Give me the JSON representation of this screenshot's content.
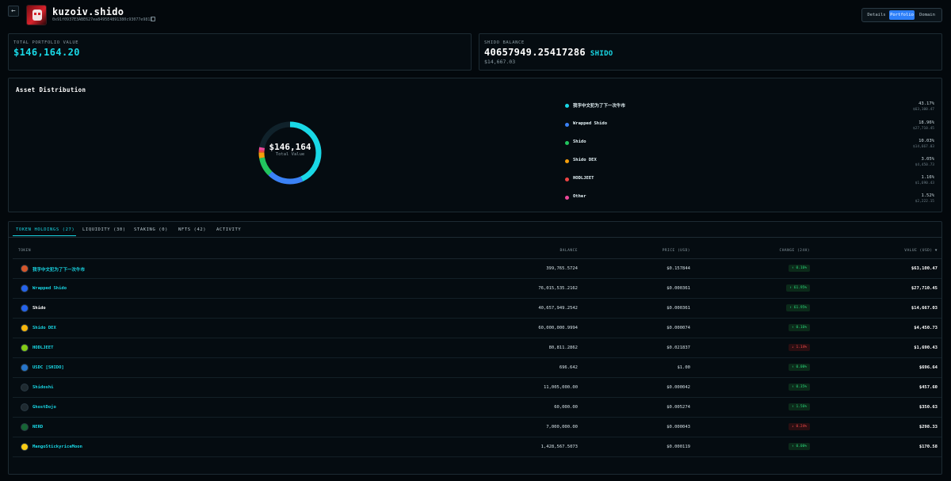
{
  "header": {
    "back_icon": "←",
    "name": "kuzoiv.shido",
    "address": "0x91f0937E3ABE627ea8495E4891380c93077e9813",
    "view_tabs": [
      "Details",
      "Portfolio",
      "Domain"
    ],
    "active_view": "Portfolio"
  },
  "portfolio": {
    "label": "TOTAL PORTFOLIO VALUE",
    "value": "$146,164.20"
  },
  "shido_balance": {
    "label": "SHIDO BALANCE",
    "amount": "40657949.25417286",
    "ticker": "SHIDO",
    "usd": "$14,667.03"
  },
  "distribution": {
    "title": "Asset Distribution",
    "center_value": "$146,164",
    "center_label": "Total Value",
    "items": [
      {
        "name": "我字中文犯为了下一次牛市",
        "pct": "43.17%",
        "usd": "$63,100.47",
        "color": "#19d8e6",
        "share": 43.17
      },
      {
        "name": "Wrapped Shido",
        "pct": "18.96%",
        "usd": "$27,710.45",
        "color": "#3b82f6",
        "share": 18.96
      },
      {
        "name": "Shido",
        "pct": "10.03%",
        "usd": "$14,667.03",
        "color": "#22c55e",
        "share": 10.03
      },
      {
        "name": "Shido DEX",
        "pct": "3.05%",
        "usd": "$4,450.73",
        "color": "#f59e0b",
        "share": 3.05
      },
      {
        "name": "HODLJEET",
        "pct": "1.16%",
        "usd": "$1,690.43",
        "color": "#ef4444",
        "share": 1.16
      },
      {
        "name": "Other",
        "pct": "1.52%",
        "usd": "$2,222.15",
        "color": "#ec4899",
        "share": 1.52
      }
    ]
  },
  "holdings": {
    "tabs": [
      "TOKEN HOLDINGS (27)",
      "LIQUIDITY (30)",
      "STAKING (0)",
      "NFTS (42)",
      "ACTIVITY"
    ],
    "active_tab": "TOKEN HOLDINGS (27)",
    "columns": {
      "token": "TOKEN",
      "balance": "BALANCE",
      "price": "PRICE (USD)",
      "change": "CHANGE (24H)",
      "value": "VALUE (USD) ▼"
    },
    "rows": [
      {
        "name": "我字中文犯为了下一次牛市",
        "balance": "399,765.5724",
        "price": "$0.157844",
        "change": "↑ 0.16%",
        "dir": "up",
        "value": "$63,100.47",
        "icon": "avatar-icon",
        "icolor": "#d4562b",
        "white": false
      },
      {
        "name": "Wrapped Shido",
        "balance": "76,015,535.2162",
        "price": "$0.000361",
        "change": "↑ 61.95%",
        "dir": "up",
        "value": "$27,710.45",
        "icon": "shido-hex-icon",
        "icolor": "#2563eb",
        "white": false
      },
      {
        "name": "Shido",
        "balance": "40,657,949.2542",
        "price": "$0.000361",
        "change": "↑ 61.95%",
        "dir": "up",
        "value": "$14,667.03",
        "icon": "shido-hex-icon",
        "icolor": "#2563eb",
        "white": true
      },
      {
        "name": "Shido DEX",
        "balance": "60,000,000.9994",
        "price": "$0.000074",
        "change": "↑ 0.16%",
        "dir": "up",
        "value": "$4,450.73",
        "icon": "shido-dex-icon",
        "icolor": "#f5b50b",
        "white": false
      },
      {
        "name": "HODLJEET",
        "balance": "80,811.2862",
        "price": "$0.021837",
        "change": "↓ 1.14%",
        "dir": "down",
        "value": "$1,690.43",
        "icon": "hodljeet-icon",
        "icolor": "#84cc16",
        "white": false
      },
      {
        "name": "USDC [SHIDO]",
        "balance": "696.642",
        "price": "$1.00",
        "change": "↑ 0.00%",
        "dir": "up",
        "value": "$696.64",
        "icon": "usdc-icon",
        "icolor": "#2775ca",
        "white": false
      },
      {
        "name": "Shidoshi",
        "balance": "11,005,000.00",
        "price": "$0.000042",
        "change": "↑ 0.35%",
        "dir": "up",
        "value": "$457.60",
        "icon": "shidoshi-icon",
        "icolor": "#1f2a30",
        "white": false
      },
      {
        "name": "GhostDojo",
        "balance": "60,000.00",
        "price": "$0.005274",
        "change": "↑ 1.56%",
        "dir": "up",
        "value": "$350.63",
        "icon": "ghostdojo-icon",
        "icolor": "#1f2a30",
        "white": false
      },
      {
        "name": "NERD",
        "balance": "7,000,000.00",
        "price": "$0.000043",
        "change": "↓ 0.24%",
        "dir": "down",
        "value": "$298.33",
        "icon": "nerd-icon",
        "icolor": "#166534",
        "white": false
      },
      {
        "name": "MangoStickyriceMoon",
        "balance": "1,428,567.5073",
        "price": "$0.000119",
        "change": "↑ 0.00%",
        "dir": "up",
        "value": "$170.58",
        "icon": "mango-icon",
        "icolor": "#facc15",
        "white": false
      }
    ]
  }
}
